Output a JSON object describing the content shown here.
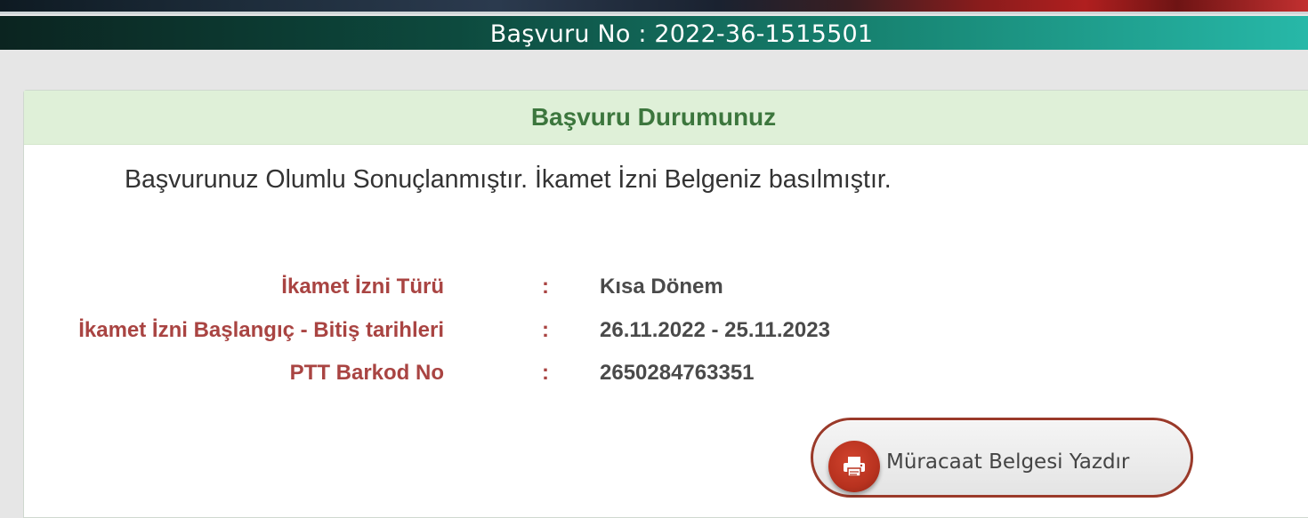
{
  "header": {
    "application_no": "Başvuru No : 2022-36-1515501"
  },
  "panel": {
    "title": "Başvuru Durumunuz",
    "status_message": "Başvurunuz Olumlu Sonuçlanmıştır. İkamet İzni Belgeniz basılmıştır."
  },
  "details": [
    {
      "label": "İkamet İzni Türü",
      "separator": ":",
      "value": "Kısa Dönem"
    },
    {
      "label": "İkamet İzni Başlangıç - Bitiş tarihleri",
      "separator": ":",
      "value": "26.11.2022 - 25.11.2023"
    },
    {
      "label": "PTT Barkod No",
      "separator": ":",
      "value": "2650284763351"
    }
  ],
  "actions": {
    "print_label": "Müracaat Belgesi Yazdır",
    "print_icon": "printer-icon"
  },
  "colors": {
    "header_gradient_end": "#27b8a8",
    "panel_heading_bg": "#dff0d8",
    "panel_title": "#3c763d",
    "label": "#a94442",
    "value": "#4a4a4a",
    "button_icon_bg": "#b8321f"
  }
}
